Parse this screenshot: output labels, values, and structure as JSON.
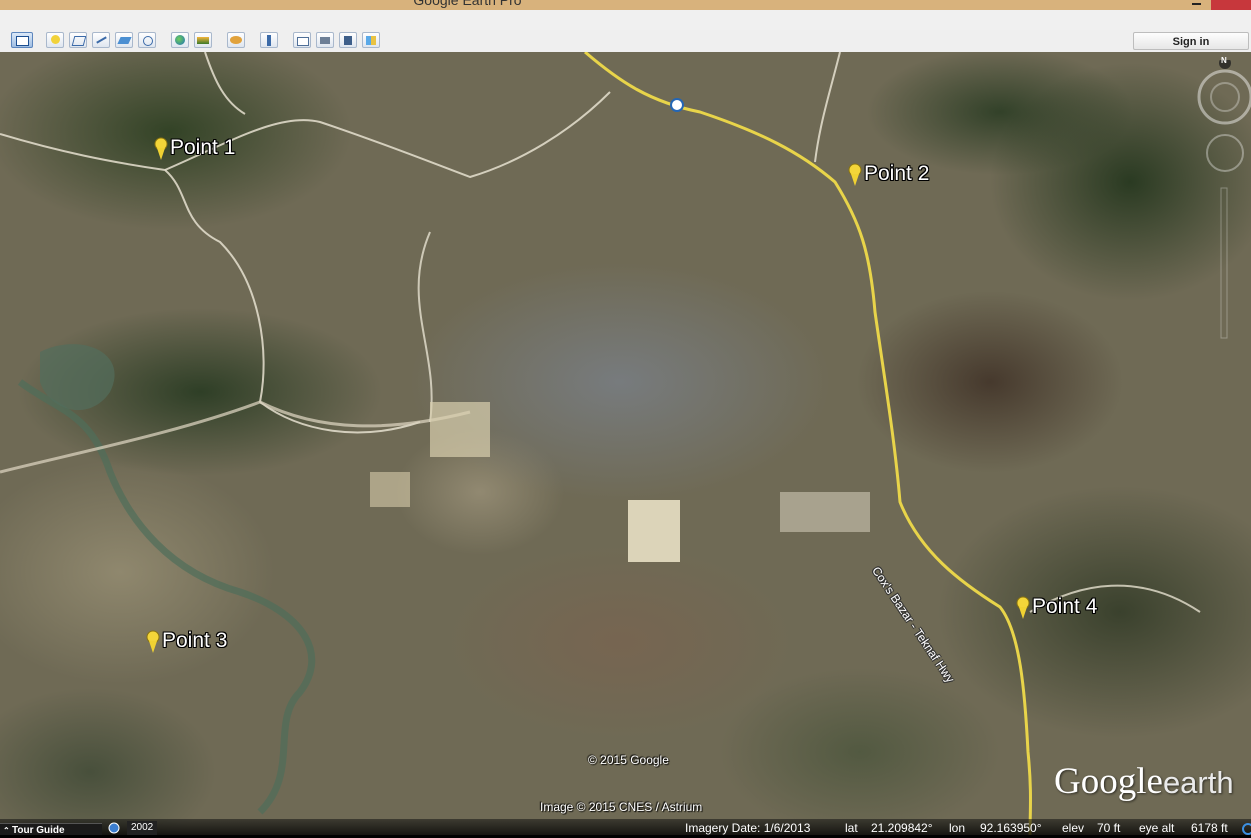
{
  "window": {
    "title": "Google Earth Pro"
  },
  "toolbar": {
    "sign_in_label": "Sign in",
    "buttons": [
      {
        "icon": "sidebar-toggle-icon",
        "x": 0
      },
      {
        "icon": "add-placemark-icon"
      },
      {
        "icon": "add-polygon-icon"
      },
      {
        "icon": "add-path-icon"
      },
      {
        "icon": "add-image-overlay-icon"
      },
      {
        "icon": "record-tour-icon"
      },
      {
        "icon": "historical-imagery-icon"
      },
      {
        "icon": "sunlight-icon"
      },
      {
        "icon": "switch-planet-icon"
      },
      {
        "icon": "ruler-icon"
      },
      {
        "icon": "email-icon"
      },
      {
        "icon": "print-icon"
      },
      {
        "icon": "save-image-icon"
      },
      {
        "icon": "view-in-maps-icon"
      }
    ]
  },
  "map": {
    "placemarks": [
      {
        "label": "Point 1"
      },
      {
        "label": "Point 2"
      },
      {
        "label": "Point 3"
      },
      {
        "label": "Point 4"
      }
    ],
    "road_label": "Cox's Bazar - Teknaf Hwy",
    "copyright_google": "© 2015 Google",
    "copyright_imagery": "Image © 2015 CNES / Astrium",
    "logo_text": "Google",
    "logo_earth": "earth",
    "compass_north": "N",
    "road_color": "#e8d44a"
  },
  "status": {
    "tour_guide_label": "Tour Guide",
    "historical_year": "2002",
    "imagery_date": "Imagery Date: 1/6/2013",
    "lat_label": "lat",
    "lat_value": "21.209842°",
    "lon_label": "lon",
    "lon_value": "92.163950°",
    "elev_label": "elev",
    "elev_value": "70 ft",
    "eye_alt_label": "eye alt",
    "eye_alt_value": "6178 ft"
  }
}
